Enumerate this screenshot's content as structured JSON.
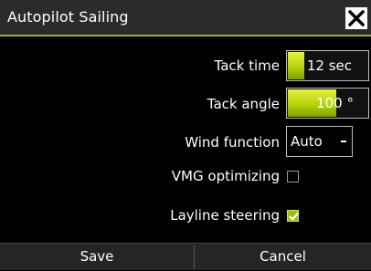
{
  "dialog": {
    "title": "Autopilot Sailing"
  },
  "settings": {
    "tack_time": {
      "label": "Tack time",
      "value": "12 sec",
      "fill_fraction": 0.2
    },
    "tack_angle": {
      "label": "Tack angle",
      "value": "100 °",
      "fill_fraction": 0.6
    },
    "wind_function": {
      "label": "Wind function",
      "selected": "Auto"
    },
    "vmg_optimizing": {
      "label": "VMG optimizing",
      "checked": false
    },
    "layline_steering": {
      "label": "Layline steering",
      "checked": true
    }
  },
  "buttons": {
    "save": "Save",
    "cancel": "Cancel"
  },
  "colors": {
    "accent": "#9ab800",
    "background": "#000000",
    "titlebar": "#2b2b2b"
  },
  "icons": {
    "close": "close-icon",
    "dropdown": "chevron-down-icon",
    "check": "checkmark-icon"
  }
}
